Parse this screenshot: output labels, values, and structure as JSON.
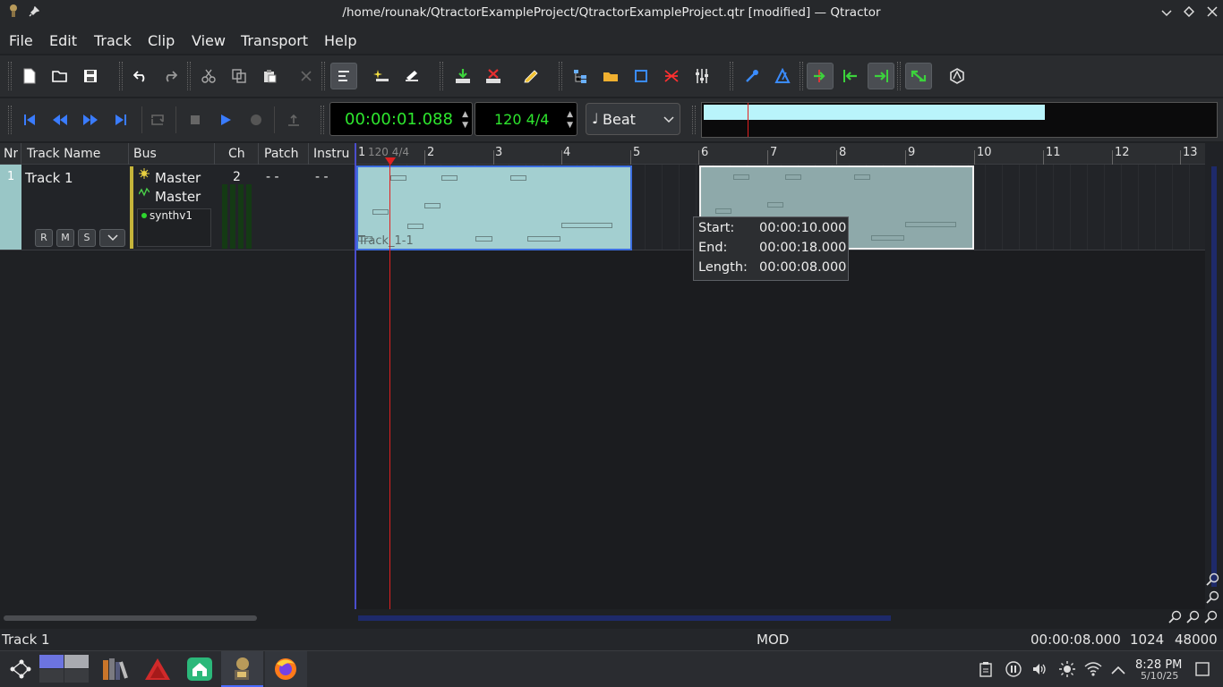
{
  "window": {
    "title": "/home/rounak/QtractorExampleProject/QtractorExampleProject.qtr [modified] — Qtractor"
  },
  "menu": [
    "File",
    "Edit",
    "Track",
    "Clip",
    "View",
    "Transport",
    "Help"
  ],
  "transport": {
    "time": "00:00:01.088",
    "tempo": "120 4/4",
    "snap": "Beat",
    "snap_icon": "♩"
  },
  "track_list": {
    "headers": [
      "Nr",
      "Track Name",
      "Bus",
      "Ch",
      "Patch",
      "Instru"
    ],
    "tracks": [
      {
        "nr": "1",
        "name": "Track 1",
        "bus_in": "Master",
        "bus_out": "Master",
        "plugin": "synthv1",
        "channel": "2",
        "patch": "- -",
        "instrument": "- -",
        "buttons": [
          "R",
          "M",
          "S"
        ]
      }
    ]
  },
  "ruler": {
    "bars": [
      "1",
      "2",
      "3",
      "4",
      "5",
      "6",
      "7",
      "8",
      "9",
      "10",
      "11",
      "12",
      "13"
    ],
    "marker": "120 4/4"
  },
  "clips": [
    {
      "name": "Track_1-1",
      "selected": true
    },
    {
      "name": "",
      "selected": false
    }
  ],
  "tooltip": {
    "start_label": "Start:",
    "start": "00:00:10.000",
    "end_label": "End:",
    "end": "00:00:18.000",
    "length_label": "Length:",
    "length": "00:00:08.000"
  },
  "status": {
    "track": "Track 1",
    "mode": "MOD",
    "length": "00:00:08.000",
    "buffer": "1024",
    "rate": "48000"
  },
  "taskbar": {
    "time": "8:28 PM",
    "date": "5/10/25"
  },
  "colors": {
    "clip_selected": "#a3cfd0",
    "clip_normal": "#8ea9aa",
    "playhead": "#e02020",
    "time_green": "#2ee62e"
  }
}
